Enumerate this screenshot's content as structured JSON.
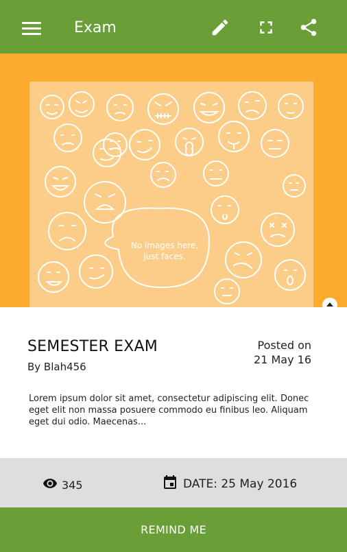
{
  "appbar": {
    "title": "Exam",
    "icons": [
      "menu-icon",
      "edit-icon",
      "fullscreen-icon",
      "share-icon"
    ]
  },
  "hero": {
    "placeholder_text": "No images here,\njust faces.",
    "collapse_icon": "chevron-up-icon"
  },
  "post": {
    "title": "SEMESTER EXAM",
    "author": "By Blah456",
    "posted_label": "Posted on",
    "posted_date": "21 May 16",
    "description": "Lorem ipsum dolor sit amet, consectetur adipiscing elit. Donec eget elit non massa posuere commodo eu finibus leo. Aliquam eget dui odio. Maecenas..."
  },
  "stats": {
    "views": "345",
    "date_text": "DATE: 25 May 2016",
    "icons": [
      "eye-icon",
      "calendar-icon"
    ]
  },
  "button": {
    "label": "REMIND ME"
  },
  "colors": {
    "appbar": "#6a9f38",
    "hero_background": "#fcab2f",
    "placeholder": "#fccd88",
    "stats_background": "#dedede",
    "button": "#6a9f38"
  }
}
